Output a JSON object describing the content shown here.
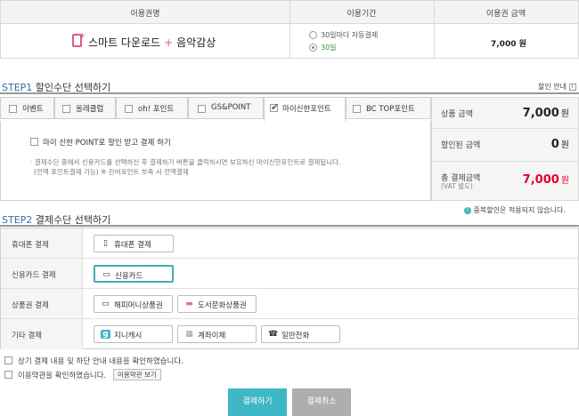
{
  "top_table": {
    "headers": [
      "이용권명",
      "이용기간",
      "이용권 금액"
    ],
    "product": {
      "part1": "스마트 다운로드",
      "plus": "+",
      "part2": "음악감상"
    },
    "period_options": [
      "30일마다 자동결제",
      "30일"
    ],
    "selected_period": "30일",
    "price": "7,000 원"
  },
  "step1": {
    "label_num": "STEP1",
    "label_text": "할인수단 선택하기",
    "discount_guide": "할인 안내",
    "tabs": [
      "이벤트",
      "올레클럽",
      "oh! 포인트",
      "GS&POINT",
      "마이신한포인트",
      "BC TOP포인트"
    ],
    "active_tab": "마이신한포인트",
    "option_label": "마이 신한 POINT로 할인 받고 결제 하기",
    "note_line1": "· 결제수단 중에서 신용카드를 선택하신 후 결제하기 버튼을 클릭하시면 보유하신 마이신한포인트로 결제됩니다.",
    "note_line2": "(전액 포인트결제 가능) ※ 잔여포인트 부족 시 전액결제"
  },
  "summary": {
    "product_amount_label": "상품 금액",
    "product_amount": "7,000",
    "discount_label": "할인된 금액",
    "discount_amount": "0",
    "total_label": "총 결제금액",
    "vat_label": "(VAT 별도)",
    "total_amount": "7,000",
    "currency": "원",
    "total_color": "#e0002a"
  },
  "notice": "중복할인은 적용되지 않습니다.",
  "step2": {
    "label_num": "STEP2",
    "label_text": "결제수단 선택하기",
    "rows": [
      {
        "label": "휴대폰 결제",
        "buttons": [
          "휴대폰 결제"
        ]
      },
      {
        "label": "신용카드 결제",
        "buttons": [
          "신용카드"
        ]
      },
      {
        "label": "상품권 결제",
        "buttons": [
          "해피머니상품권",
          "도서문화상품권"
        ]
      },
      {
        "label": "기타 결제",
        "buttons": [
          "지니캐시",
          "계좌이체",
          "일반전화"
        ]
      }
    ],
    "selected": "신용카드"
  },
  "agreements": {
    "line1": "상기 결제 내용 및 하단 안내 내용을 확인하였습니다.",
    "line2": "이용약관을 확인하였습니다.",
    "terms_button": "이용약관 보기"
  },
  "actions": {
    "pay": "결제하기",
    "cancel": "결제취소"
  }
}
